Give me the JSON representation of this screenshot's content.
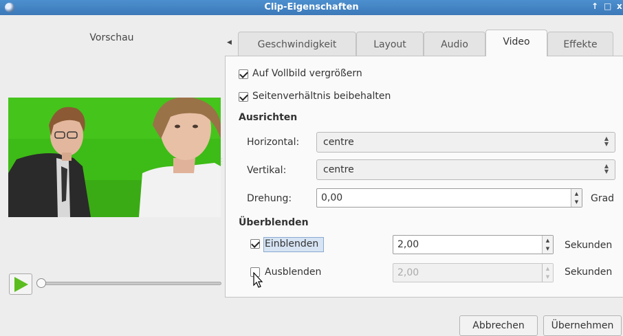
{
  "window": {
    "title": "Clip-Eigenschaften",
    "pin_glyph": "↑",
    "max_glyph": "□",
    "close_glyph": "x"
  },
  "preview": {
    "label": "Vorschau",
    "play_icon": "play-icon",
    "position": 0.0
  },
  "tabs": [
    {
      "label": "Geschwindigkeit",
      "active": false
    },
    {
      "label": "Layout",
      "active": false
    },
    {
      "label": "Audio",
      "active": false
    },
    {
      "label": "Video",
      "active": true
    },
    {
      "label": "Effekte",
      "active": false
    }
  ],
  "tab_scroll_glyph": "◀",
  "video": {
    "fullscreen": {
      "label": "Auf Vollbild vergrößern",
      "checked": true
    },
    "aspect": {
      "label": "Seitenverhältnis beibehalten",
      "checked": true
    },
    "align": {
      "heading": "Ausrichten",
      "horizontal_label": "Horizontal:",
      "horizontal_value": "centre",
      "vertical_label": "Vertikal:",
      "vertical_value": "centre",
      "rotation_label": "Drehung:",
      "rotation_value": "0,00",
      "rotation_unit": "Grad"
    },
    "fade": {
      "heading": "Überblenden",
      "fade_in": {
        "label": "Einblenden",
        "checked": true,
        "value": "2,00",
        "unit": "Sekunden"
      },
      "fade_out": {
        "label": "Ausblenden",
        "checked": false,
        "value": "2,00",
        "unit": "Sekunden"
      }
    }
  },
  "buttons": {
    "cancel": "Abbrechen",
    "apply": "Übernehmen"
  },
  "colors": {
    "titlebar": "#3b78b8",
    "green_screen": "#3dbb16",
    "play": "#5cbd20"
  }
}
